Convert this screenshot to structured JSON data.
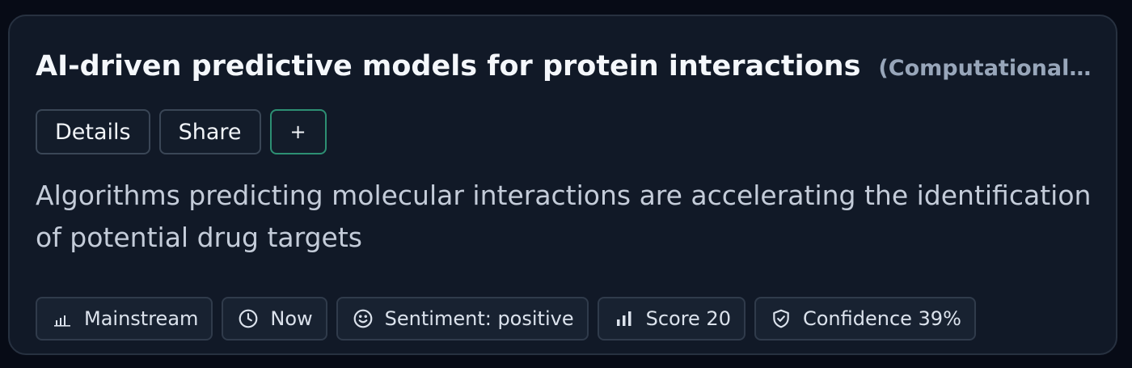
{
  "card": {
    "title": "AI-driven predictive models for protein interactions",
    "category": "(Computational Biol...",
    "description": "Algorithms predicting molecular interactions are accelerating the identification of potential drug targets"
  },
  "actions": {
    "details_label": "Details",
    "share_label": "Share",
    "add_label": "+"
  },
  "chips": [
    {
      "icon": "bar-chart-icon",
      "label": "Mainstream"
    },
    {
      "icon": "clock-icon",
      "label": "Now"
    },
    {
      "icon": "smile-icon",
      "label": "Sentiment: positive"
    },
    {
      "icon": "signal-bars-icon",
      "label": "Score 20"
    },
    {
      "icon": "shield-check-icon",
      "label": "Confidence 39%"
    }
  ],
  "colors": {
    "background": "#070b16",
    "card": "#111927",
    "accent_border": "#2d8f73",
    "title": "#f4f7fb",
    "muted": "#98a6ba"
  }
}
